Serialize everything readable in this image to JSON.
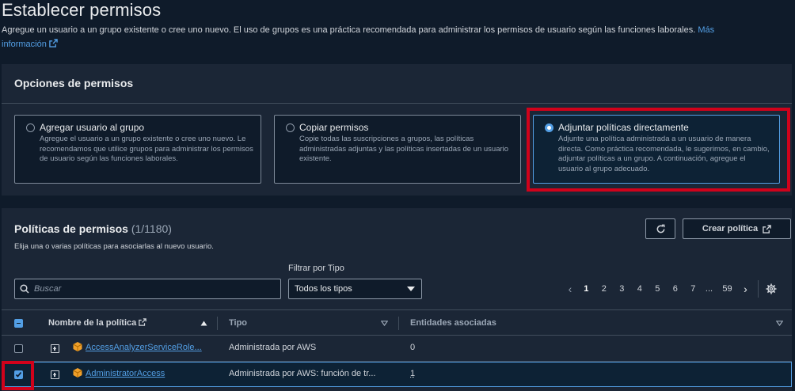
{
  "header": {
    "title": "Establecer permisos",
    "description": "Agregue un usuario a un grupo existente o cree uno nuevo. El uso de grupos es una práctica recomendada para administrar los permisos de usuario según las funciones laborales.",
    "more_info_line1": "Más",
    "more_info_line2": "información"
  },
  "options": {
    "title": "Opciones de permisos",
    "tiles": [
      {
        "label": "Agregar usuario al grupo",
        "desc": "Agregue el usuario a un grupo existente o cree uno nuevo. Le recomendamos que utilice grupos para administrar los permisos de usuario según las funciones laborales."
      },
      {
        "label": "Copiar permisos",
        "desc": "Copie todas las suscripciones a grupos, las políticas administradas adjuntas y las políticas insertadas de un usuario existente."
      },
      {
        "label": "Adjuntar políticas directamente",
        "desc": "Adjunte una política administrada a un usuario de manera directa. Como práctica recomendada, le sugerimos, en cambio, adjuntar políticas a un grupo. A continuación, agregue el usuario al grupo adecuado."
      }
    ],
    "selected_index": 2
  },
  "policies": {
    "title": "Políticas de permisos",
    "count": "(1/1180)",
    "description": "Elija una o varias políticas para asociarlas al nuevo usuario.",
    "create_button": "Crear política",
    "filter_label": "Filtrar por Tipo",
    "search_placeholder": "Buscar",
    "filter_value": "Todos los tipos",
    "pagination": {
      "current": "1",
      "pages": [
        "1",
        "2",
        "3",
        "4",
        "5",
        "6",
        "7"
      ],
      "ellipsis": "...",
      "last": "59"
    },
    "columns": {
      "name": "Nombre de la política",
      "type": "Tipo",
      "entities": "Entidades asociadas"
    },
    "rows": [
      {
        "name": "AccessAnalyzerServiceRole...",
        "type": "Administrada por AWS",
        "entities": "0",
        "checked": false
      },
      {
        "name": "AdministratorAccess",
        "type": "Administrada por AWS: función de tr...",
        "entities": "1",
        "checked": true
      }
    ]
  },
  "colors": {
    "accent": "#539fe5",
    "highlight": "#d0021b",
    "background": "#0f1b2a",
    "panel": "#1b2636"
  },
  "icons": [
    "external-link-icon",
    "refresh-icon",
    "search-icon",
    "caret-down-icon",
    "chevron-left-icon",
    "chevron-right-icon",
    "gear-icon",
    "sort-up-icon",
    "sort-down-icon",
    "expand-icon",
    "policy-cube-icon"
  ]
}
